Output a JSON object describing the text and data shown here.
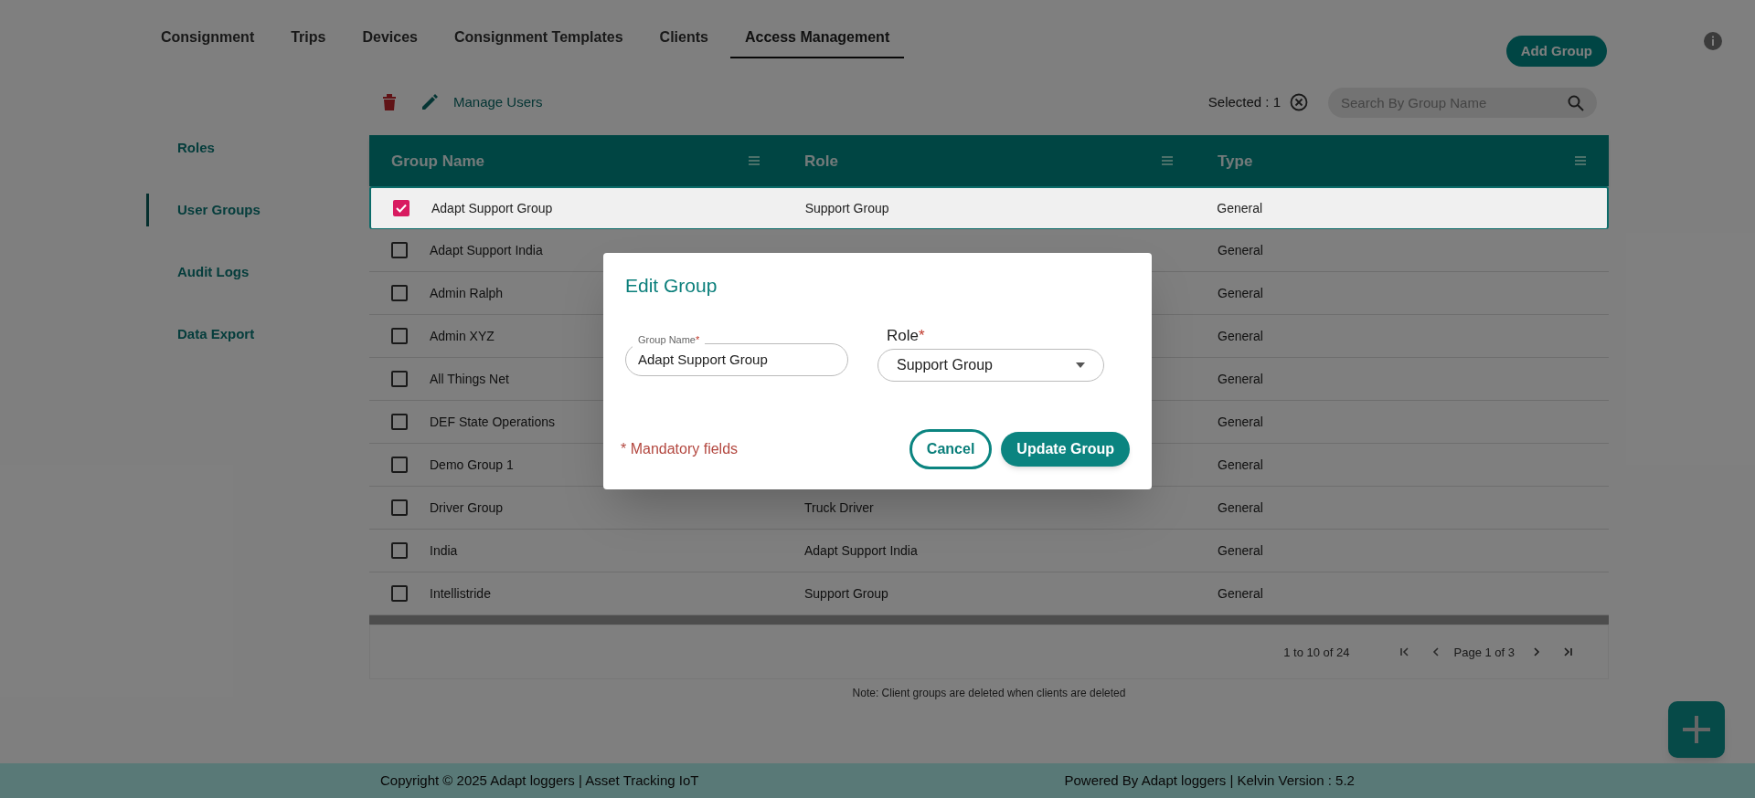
{
  "nav": {
    "tabs": [
      {
        "label": "Consignment",
        "selected": false
      },
      {
        "label": "Trips",
        "selected": false
      },
      {
        "label": "Devices",
        "selected": false
      },
      {
        "label": "Consignment Templates",
        "selected": false
      },
      {
        "label": "Clients",
        "selected": false
      },
      {
        "label": "Access Management",
        "selected": true
      }
    ]
  },
  "add_button": "Add Group",
  "sidebar": {
    "items": [
      {
        "label": "Roles",
        "selected": false
      },
      {
        "label": "User Groups",
        "selected": true
      },
      {
        "label": "Audit Logs",
        "selected": false
      },
      {
        "label": "Data Export",
        "selected": false
      }
    ]
  },
  "toolbar": {
    "manage_users": "Manage Users",
    "selected_count": "Selected : 1",
    "search": {
      "placeholder": "Search By Group Name"
    }
  },
  "table": {
    "columns": [
      "Group Name",
      "Role",
      "Type"
    ],
    "rows": [
      {
        "group": "Adapt Support Group",
        "role": "Support Group",
        "type": "General",
        "checked": true
      },
      {
        "group": "Adapt Support India",
        "type": "General",
        "checked": false
      },
      {
        "group": "Admin Ralph",
        "type": "General",
        "checked": false
      },
      {
        "group": "Admin XYZ",
        "type": "General",
        "checked": false
      },
      {
        "group": "All Things Net",
        "type": "General",
        "checked": false
      },
      {
        "group": "DEF State Operations",
        "type": "General",
        "checked": false
      },
      {
        "group": "Demo Group 1",
        "type": "General",
        "checked": false
      },
      {
        "group": "Driver Group",
        "role": "Truck Driver",
        "type": "General",
        "checked": false
      },
      {
        "group": "India",
        "role": "Adapt Support India",
        "type": "General",
        "checked": false
      },
      {
        "group": "Intellistride",
        "role": "Support Group",
        "type": "General",
        "checked": false
      }
    ]
  },
  "pagination": {
    "range": "1 to 10 of 24",
    "page": "Page 1 of 3"
  },
  "note": "Note: Client groups are deleted when clients are deleted",
  "dialog": {
    "title": "Edit Group",
    "group_name": {
      "label": "Group Name",
      "required_mark": "*",
      "value": "Adapt Support Group"
    },
    "role": {
      "label": "Role",
      "required_mark": "*",
      "value": "Support Group"
    },
    "mandatory_note": "* Mandatory fields",
    "cancel": "Cancel",
    "submit": "Update Group"
  },
  "footer": {
    "left": "Copyright © 2025 Adapt loggers | Asset Tracking IoT",
    "right": "Powered By Adapt loggers | Kelvin Version : 5.2"
  }
}
